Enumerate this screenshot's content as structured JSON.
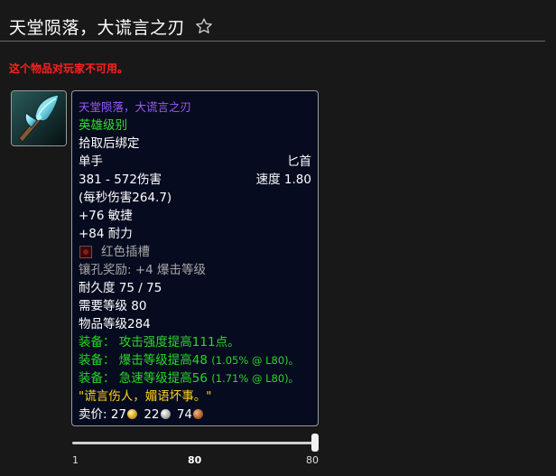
{
  "page": {
    "title": "天堂陨落，大谎言之刃",
    "warning": "这个物品对玩家不可用。"
  },
  "item": {
    "icon": "axe-weapon-icon",
    "name": "天堂陨落，大谎言之刃",
    "quality": "英雄级别",
    "binding": "拾取后绑定",
    "slot": "单手",
    "type": "匕首",
    "damage": "381 - 572伤害",
    "speed": "速度 1.80",
    "dps": "(每秒伤害264.7)",
    "stat_agility": "+76 敏捷",
    "stat_stamina": "+84 耐力",
    "socket": "红色插槽",
    "socket_bonus": "镶孔奖励: +4 爆击等级",
    "durability": "耐久度 75 / 75",
    "required_level": "需要等级 80",
    "item_level": "物品等级284",
    "equip": [
      {
        "label": "装备：",
        "text": "攻击强度提高111点。",
        "note": ""
      },
      {
        "label": "装备：",
        "text": "爆击等级提高48",
        "note": "(1.05% @ L80)。"
      },
      {
        "label": "装备：",
        "text": "急速等级提高56",
        "note": "(1.71% @ L80)。"
      }
    ],
    "flavor": "\"谎言伤人，媚语坏事。\"",
    "sell_label": "卖价:",
    "sell_gold": "27",
    "sell_silver": "22",
    "sell_copper": "74"
  },
  "level_slider": {
    "min_label": "1",
    "value_label": "80",
    "max_label": "80",
    "value_fraction": 1.0
  },
  "colors": {
    "epic_name": "#9b59ff",
    "quality": "#33dd33",
    "equip": "#2bd52b",
    "flavor": "#ffd21a",
    "warning": "#ff2020"
  }
}
